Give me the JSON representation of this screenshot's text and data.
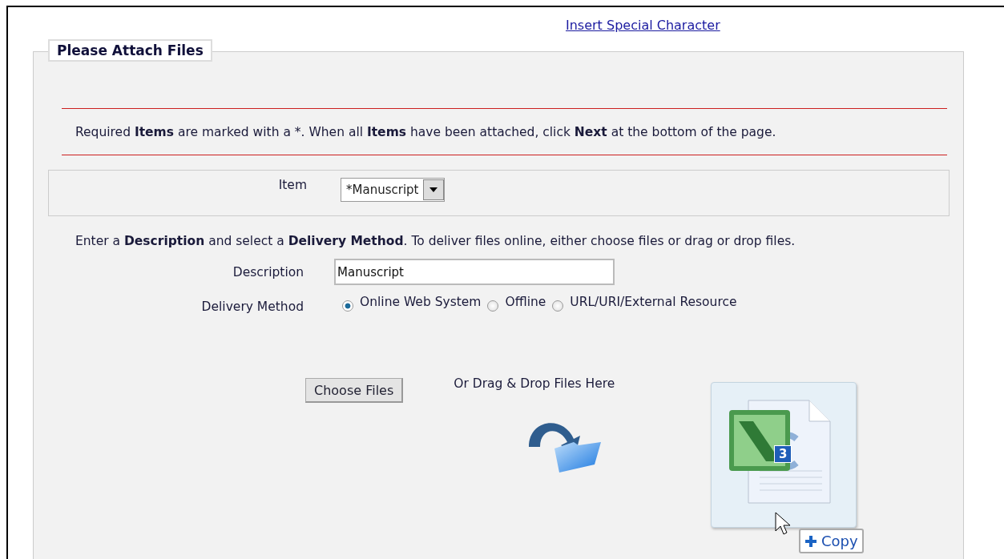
{
  "link": "Insert Special Character",
  "fieldset": {
    "legend": "Please Attach Files",
    "notice": "Required **Items** are marked with a *. When all **Items** have been attached, click **Next** at the bottom of the page.",
    "item": {
      "label": "Item",
      "value": "*Manuscript"
    },
    "instructions": "Enter a **Description** and select a **Delivery Method**. To deliver files online, either choose files or drag or drop files.",
    "description": {
      "label": "Description",
      "value": "Manuscript"
    },
    "delivery": {
      "label": "Delivery Method",
      "options": [
        {
          "label": "Online Web System",
          "selected": true
        },
        {
          "label": "Offline",
          "selected": false
        },
        {
          "label": "URL/URI/External Resource",
          "selected": false
        }
      ]
    },
    "choose_button": "Choose Files",
    "drop_text": "Or Drag & Drop Files Here",
    "drag": {
      "count": "3",
      "tooltip": "Copy"
    }
  }
}
